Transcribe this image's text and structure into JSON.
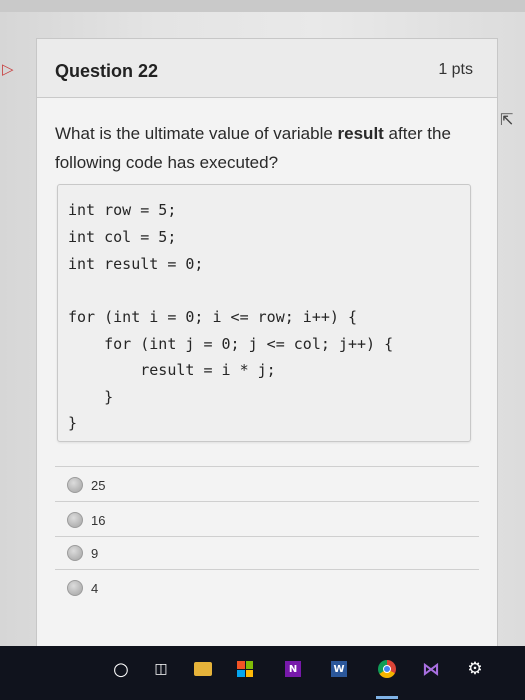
{
  "question": {
    "title": "Question 22",
    "points": "1 pts",
    "prompt_before": "What is the ultimate value of variable ",
    "prompt_bold": "result",
    "prompt_after": " after the following code has executed?"
  },
  "code_lines": [
    "int row = 5;",
    "int col = 5;",
    "int result = 0;",
    "for (int i = 0; i <= row; i++) {",
    "    for (int j = 0; j <= col; j++) {",
    "        result = i * j;",
    "    }",
    "}"
  ],
  "answers": [
    {
      "label": "25"
    },
    {
      "label": "16"
    },
    {
      "label": "9"
    },
    {
      "label": "4"
    }
  ],
  "taskbar": {
    "onenote_letter": "N",
    "word_letter": "W"
  },
  "icons": {
    "flag": "flag-icon",
    "cortana": "cortana-circle-icon",
    "task_view": "task-view-icon",
    "file_explorer": "folder-icon",
    "store": "store-icon",
    "onenote": "onenote-icon",
    "word": "word-icon",
    "chrome": "chrome-icon",
    "visual_studio": "visual-studio-icon",
    "settings": "gear-icon"
  },
  "colors": {
    "taskbar_bg": "#10131d",
    "flag": "#c84040"
  }
}
